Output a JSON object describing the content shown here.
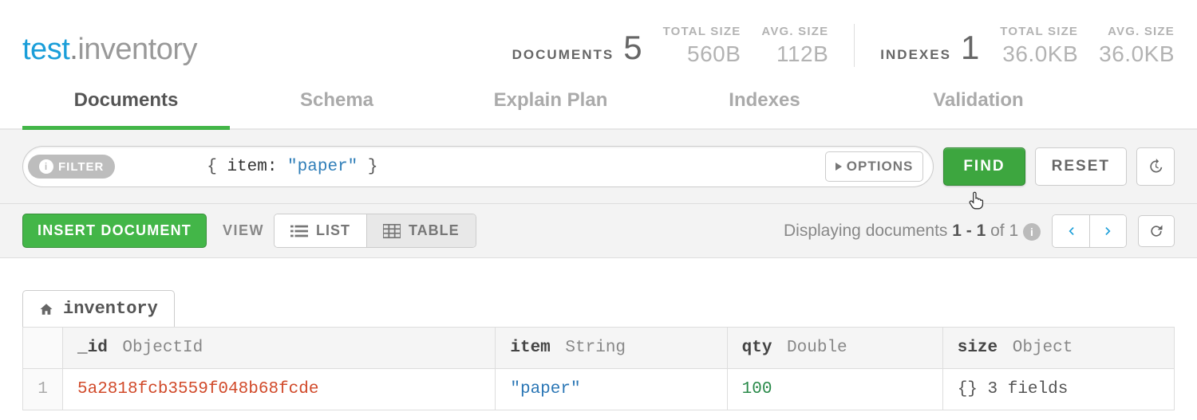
{
  "namespace": {
    "db": "test",
    "collection": "inventory"
  },
  "stats": {
    "doc_label": "DOCUMENTS",
    "doc_count": "5",
    "doc_total_size_label": "TOTAL SIZE",
    "doc_total_size": "560B",
    "doc_avg_size_label": "AVG. SIZE",
    "doc_avg_size": "112B",
    "idx_label": "INDEXES",
    "idx_count": "1",
    "idx_total_size_label": "TOTAL SIZE",
    "idx_total_size": "36.0KB",
    "idx_avg_size_label": "AVG. SIZE",
    "idx_avg_size": "36.0KB"
  },
  "tabs": [
    "Documents",
    "Schema",
    "Explain Plan",
    "Indexes",
    "Validation"
  ],
  "filter": {
    "pill": "FILTER",
    "open": "{ ",
    "key": "item:",
    "value": " \"paper\"",
    "close": " }",
    "raw": "{ item: \"paper\" }",
    "options": "OPTIONS",
    "find": "FIND",
    "reset": "RESET"
  },
  "toolbar": {
    "insert": "INSERT DOCUMENT",
    "view": "VIEW",
    "list": "LIST",
    "table": "TABLE"
  },
  "pager": {
    "prefix": "Displaying documents ",
    "bold": "1 - 1",
    "mid": " of 1 ",
    "info": "i"
  },
  "breadcrumb": "inventory",
  "columns": [
    {
      "name": "_id",
      "type": "ObjectId"
    },
    {
      "name": "item",
      "type": "String"
    },
    {
      "name": "qty",
      "type": "Double"
    },
    {
      "name": "size",
      "type": "Object"
    }
  ],
  "rows": [
    {
      "n": "1",
      "_id": "5a2818fcb3559f048b68fcde",
      "item": "\"paper\"",
      "qty": "100",
      "size": "{} 3 fields"
    }
  ]
}
